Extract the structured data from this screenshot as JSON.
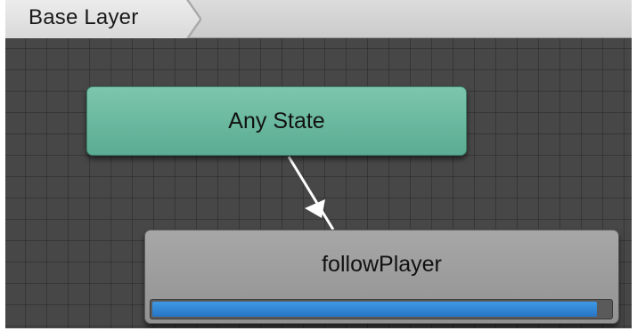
{
  "breadcrumb": {
    "layer_label": "Base Layer"
  },
  "states": {
    "any_state": {
      "label": "Any State",
      "color": "#66b59c"
    },
    "follow_player": {
      "label": "followPlayer",
      "color": "#9d9d9d"
    }
  },
  "progress": {
    "fraction": 0.97,
    "color": "#2f86d6"
  },
  "transition": {
    "from": "Any State",
    "to": "followPlayer"
  }
}
